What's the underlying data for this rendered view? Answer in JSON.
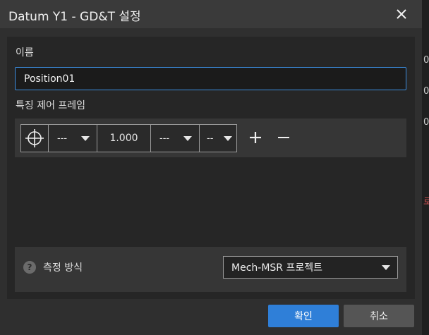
{
  "dialog": {
    "title": "Datum Y1 - GD&T 설정",
    "close_icon": "close-icon"
  },
  "name_field": {
    "label": "이름",
    "value": "Position01"
  },
  "feature_control_frame": {
    "label": "특징 제어 프레임",
    "symbol_icon": "position-symbol-icon",
    "modifier_dropdown": "---",
    "tolerance_value": "1.000",
    "material_condition_dropdown": "---",
    "datum_dropdown": "--",
    "add_icon": "plus-icon",
    "remove_icon": "minus-icon"
  },
  "measurement": {
    "help_icon": "?",
    "label": "측정 방식",
    "selected": "Mech-MSR 프로젝트"
  },
  "buttons": {
    "ok": "확인",
    "cancel": "취소"
  },
  "background_window": {
    "fragments": [
      "0",
      "0",
      "0",
      "로"
    ]
  }
}
